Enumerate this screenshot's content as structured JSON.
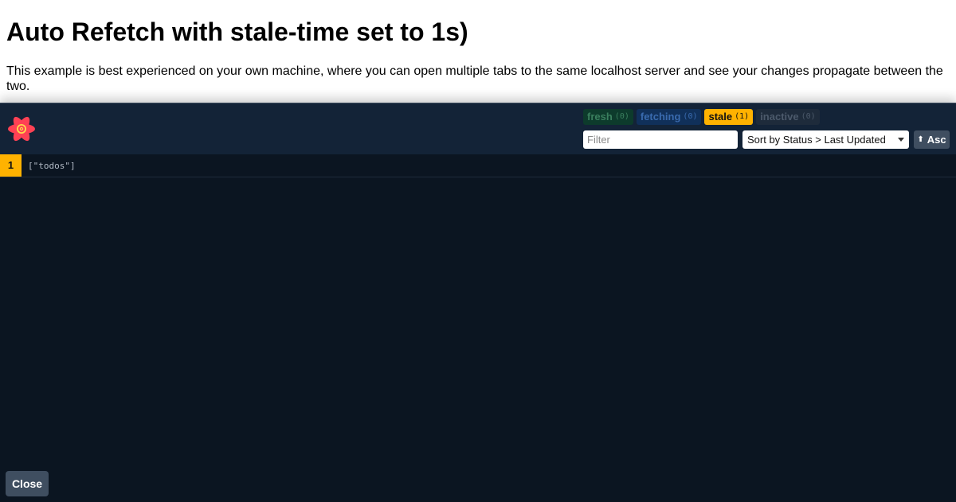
{
  "page": {
    "title": "Auto Refetch with stale-time set to 1s)",
    "description": "This example is best experienced on your own machine, where you can open multiple tabs to the same localhost server and see your changes propagate between the two."
  },
  "devtools": {
    "logo_icon": "react-query-flower-logo",
    "badges": {
      "fresh": {
        "label": "fresh",
        "count": "(0)"
      },
      "fetching": {
        "label": "fetching",
        "count": "(0)"
      },
      "stale": {
        "label": "stale",
        "count": "(1)"
      },
      "inactive": {
        "label": "inactive",
        "count": "(0)"
      }
    },
    "filter": {
      "placeholder": "Filter",
      "value": ""
    },
    "sort": {
      "selected": "Sort by Status > Last Updated"
    },
    "order_button": {
      "icon": "up-arrow-icon",
      "label": "Asc"
    },
    "queries": [
      {
        "observers": "1",
        "key": "[\"todos\"]"
      }
    ],
    "close_label": "Close"
  },
  "colors": {
    "panel_bg": "#0b1521",
    "header_bg": "#132337",
    "stale_accent": "#ffb200",
    "button_bg": "#3f4e60"
  }
}
